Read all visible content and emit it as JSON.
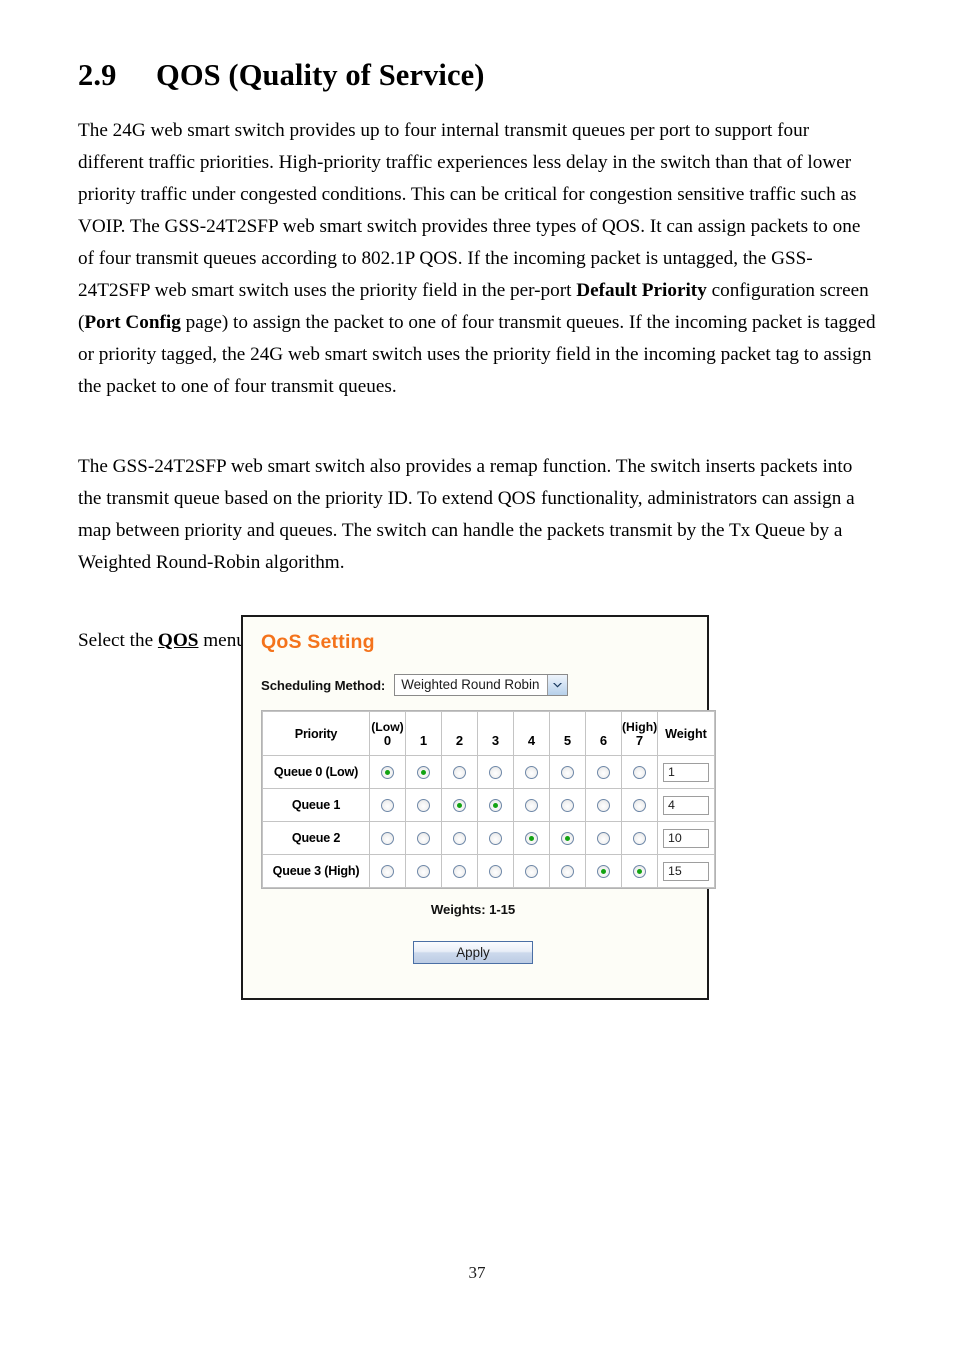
{
  "document": {
    "section_number": "2.9",
    "heading": "QOS (Quality of Service)",
    "paragraphs": {
      "p1_a": "The 24G web smart switch provides up to four internal transmit queues per port to support four different traffic priorities. High-priority traffic experiences less delay in the switch than that of lower priority traffic under congested conditions. This can be critical for congestion sensitive traffic such as VOIP. The GSS-24T2SFP web smart switch provides three types of QOS. It can assign packets to one of four transmit queues according to 802.1P QOS. If the incoming packet is untagged, the GSS-24T2SFP web smart switch uses the priority field in the per-port ",
      "p1_bold1": "Default Priority",
      "p1_b": " configuration screen (",
      "p1_bold2": "Port Config",
      "p1_c": " page) to assign the packet to one of four transmit queues. If the incoming packet is tagged or priority tagged, the 24G web smart switch uses the priority field in the incoming packet tag to assign the packet to one of four transmit queues.",
      "p2": "The GSS-24T2SFP web smart switch also provides a remap function. The switch inserts packets into the transmit queue based on the priority ID. To extend QOS functionality, administrators can assign a map between priority and queues. The switch can handle the packets transmit by the Tx Queue by a Weighted Round-Robin algorithm.",
      "p3_a": "Select the ",
      "p3_link": "QOS",
      "p3_b": " menu on the web page to activate the page shown as below."
    },
    "page_number": "37"
  },
  "screenshot": {
    "title": "QoS Setting",
    "title_color": "#f4731c",
    "scheduling": {
      "label": "Scheduling Method:",
      "selected": "Weighted Round Robin",
      "arrow_icon": "chevron-down-icon"
    },
    "table": {
      "headers": {
        "priority": "Priority",
        "low_tag": "(Low)",
        "high_tag": "(High)",
        "numbers": [
          "0",
          "1",
          "2",
          "3",
          "4",
          "5",
          "6",
          "7"
        ],
        "weight": "Weight"
      },
      "rows": [
        {
          "label": "Queue 0  (Low)",
          "selected": [
            true,
            true,
            false,
            false,
            false,
            false,
            false,
            false
          ],
          "weight": "1"
        },
        {
          "label": "Queue 1",
          "selected": [
            false,
            false,
            true,
            true,
            false,
            false,
            false,
            false
          ],
          "weight": "4"
        },
        {
          "label": "Queue 2",
          "selected": [
            false,
            false,
            false,
            false,
            true,
            true,
            false,
            false
          ],
          "weight": "10"
        },
        {
          "label": "Queue 3  (High)",
          "selected": [
            false,
            false,
            false,
            false,
            false,
            false,
            true,
            true
          ],
          "weight": "15"
        }
      ]
    },
    "weights_note": "Weights: 1-15",
    "apply_label": "Apply"
  }
}
